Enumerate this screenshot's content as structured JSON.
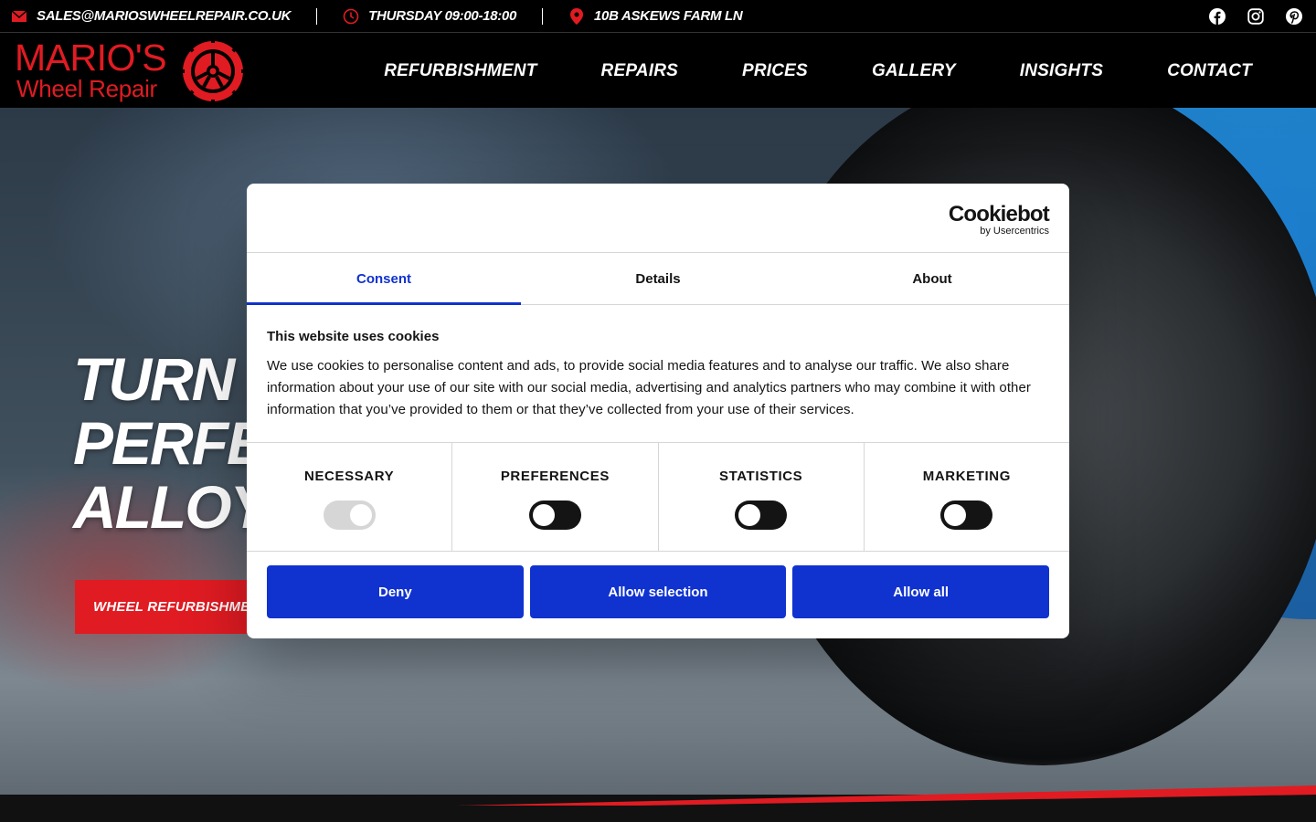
{
  "topbar": {
    "email": "SALES@MARIOSWHEELREPAIR.CO.UK",
    "hours": "THURSDAY 09:00-18:00",
    "address": "10B ASKEWS FARM LN",
    "icons": [
      "envelope-icon",
      "clock-icon",
      "map-pin-icon"
    ],
    "social": [
      "facebook-icon",
      "instagram-icon",
      "pinterest-icon"
    ]
  },
  "logo": {
    "line1": "MARIO'S",
    "line2": "Wheel Repair"
  },
  "nav": {
    "items": [
      "REFURBISHMENT",
      "REPAIRS",
      "PRICES",
      "GALLERY",
      "INSIGHTS",
      "CONTACT"
    ]
  },
  "hero": {
    "title_lines": [
      "TURN I",
      "PERFE",
      "ALLOY"
    ],
    "button": "WHEEL REFURBISHME"
  },
  "cookie_dialog": {
    "brand": "Cookiebot",
    "brand_sub": "by Usercentrics",
    "tabs": [
      "Consent",
      "Details",
      "About"
    ],
    "active_tab": "Consent",
    "heading": "This website uses cookies",
    "text": "We use cookies to personalise content and ads, to provide social media features and to analyse our traffic. We also share information about your use of our site with our social media, advertising and analytics partners who may combine it with other information that you’ve provided to them or that they’ve collected from your use of their services.",
    "categories": [
      {
        "label": "NECESSARY",
        "checked": true,
        "disabled": true
      },
      {
        "label": "PREFERENCES",
        "checked": false,
        "disabled": false
      },
      {
        "label": "STATISTICS",
        "checked": false,
        "disabled": false
      },
      {
        "label": "MARKETING",
        "checked": false,
        "disabled": false
      }
    ],
    "buttons": {
      "deny": "Deny",
      "selection": "Allow selection",
      "all": "Allow all"
    }
  },
  "colors": {
    "brand_red": "#e11b22",
    "cookiebot_blue": "#1032cf",
    "black": "#000000"
  }
}
